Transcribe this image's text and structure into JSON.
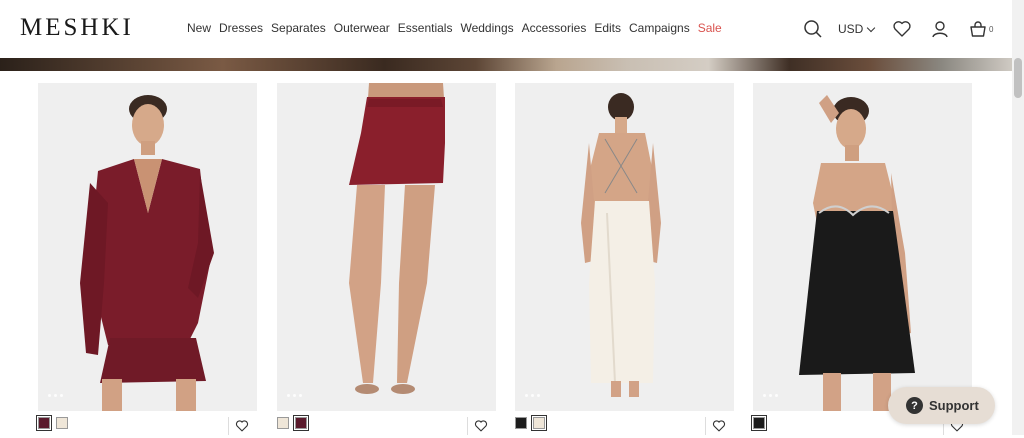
{
  "brand": {
    "logo": "MESHKI"
  },
  "nav": {
    "items": [
      "New",
      "Dresses",
      "Separates",
      "Outerwear",
      "Essentials",
      "Weddings",
      "Accessories",
      "Edits",
      "Campaigns"
    ],
    "sale": "Sale"
  },
  "header": {
    "currency": "USD",
    "cart_count": "0",
    "icons": [
      "search-icon",
      "chevron-down-icon",
      "heart-icon",
      "user-icon",
      "bag-icon"
    ]
  },
  "products": [
    {
      "garment": "burgundy satin blazer and mini skirt set",
      "swatches": [
        "#5a1a2c",
        "#efe6d8"
      ],
      "selected": 0
    },
    {
      "garment": "burgundy satin mini skirt",
      "swatches": [
        "#efe6d8",
        "#5a1a2c"
      ],
      "selected": 1
    },
    {
      "garment": "ivory satin backless maxi dress",
      "swatches": [
        "#1c1c1c",
        "#efe6d8"
      ],
      "selected": 1
    },
    {
      "garment": "black satin embellished mini dress",
      "swatches": [
        "#1c1c1c"
      ],
      "selected": 0
    }
  ],
  "support": {
    "label": "Support",
    "icon": "question-icon"
  },
  "colors": {
    "sale": "#d9534f",
    "support_bg": "#e6ddd4",
    "burgundy": "#7a1c2a"
  }
}
